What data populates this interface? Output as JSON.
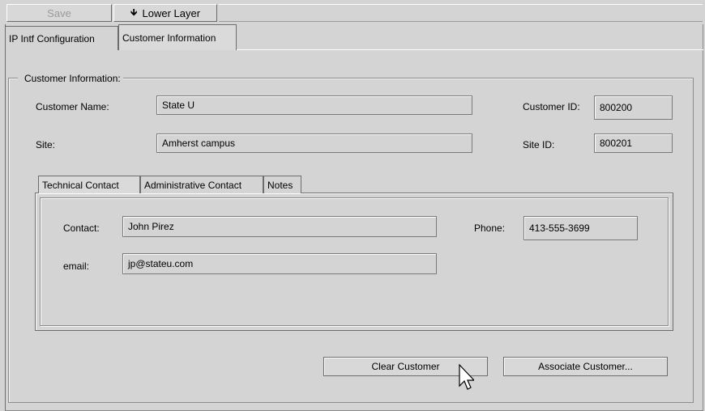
{
  "toolbar": {
    "save_label": "Save",
    "lower_layer_label": "Lower Layer",
    "lower_layer_icon": "down-arrow-icon"
  },
  "tabs": [
    {
      "label": "IP Intf Configuration",
      "active": false
    },
    {
      "label": "Customer Information",
      "active": true
    }
  ],
  "customer": {
    "group_title": "Customer Information:",
    "name_label": "Customer Name:",
    "name_value": "State U",
    "id_label": "Customer ID:",
    "id_value": "800200",
    "site_label": "Site:",
    "site_value": "Amherst campus",
    "site_id_label": "Site ID:",
    "site_id_value": "800201"
  },
  "contact_tabs": [
    {
      "label": "Technical Contact",
      "active": true
    },
    {
      "label": "Administrative Contact",
      "active": false
    },
    {
      "label": "Notes",
      "active": false
    }
  ],
  "contact": {
    "contact_label": "Contact:",
    "contact_value": "John Pirez",
    "phone_label": "Phone:",
    "phone_value": "413-555-3699",
    "email_label": "email:",
    "email_value": "jp@stateu.com"
  },
  "actions": {
    "clear_label": "Clear Customer",
    "associate_label": "Associate Customer..."
  }
}
